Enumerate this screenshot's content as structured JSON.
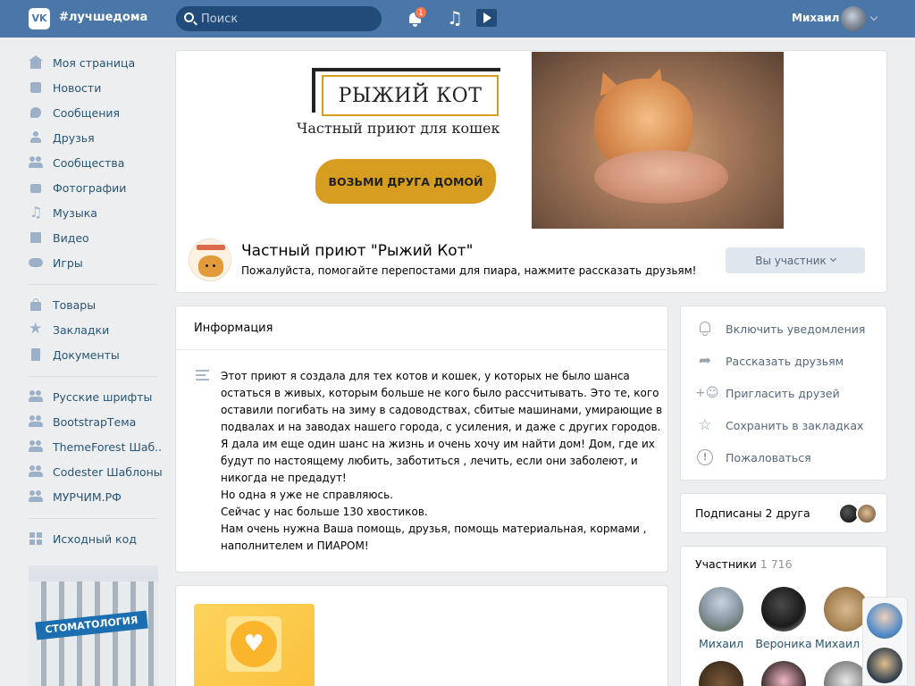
{
  "header": {
    "logo": "VK",
    "hashtag": "#лучшедома",
    "search_placeholder": "Поиск",
    "notifications_badge": "1",
    "user_name": "Михаил"
  },
  "sidebar": {
    "main_items": [
      {
        "label": "Моя страница",
        "icon": "home-icon"
      },
      {
        "label": "Новости",
        "icon": "news-icon"
      },
      {
        "label": "Сообщения",
        "icon": "messages-icon"
      },
      {
        "label": "Друзья",
        "icon": "friends-icon"
      },
      {
        "label": "Сообщества",
        "icon": "communities-icon"
      },
      {
        "label": "Фотографии",
        "icon": "camera-icon"
      },
      {
        "label": "Музыка",
        "icon": "music-icon"
      },
      {
        "label": "Видео",
        "icon": "video-icon"
      },
      {
        "label": "Игры",
        "icon": "gamepad-icon"
      }
    ],
    "secondary_items": [
      {
        "label": "Товары",
        "icon": "bag-icon"
      },
      {
        "label": "Закладки",
        "icon": "star-icon"
      },
      {
        "label": "Документы",
        "icon": "document-icon"
      }
    ],
    "groups": [
      {
        "label": "Русские шрифты"
      },
      {
        "label": "BootstrapТема"
      },
      {
        "label": "ThemeForest Шаб.."
      },
      {
        "label": "Codester Шаблоны"
      },
      {
        "label": "МУРЧИМ.РФ"
      }
    ],
    "source_code": "Исходный код",
    "promo_sign": "СТОМАТОЛОГИЯ"
  },
  "cover": {
    "brand_title": "РЫЖИЙ КОТ",
    "brand_subtitle": "Частный приют для кошек",
    "cta": "ВОЗЬМИ ДРУГА ДОМОЙ"
  },
  "group": {
    "name": "Частный приют \"Рыжий Кот\"",
    "status": "Пожалуйста, помогайте перепостами для пиара, нажмите рассказать друзьям!",
    "member_button": "Вы участник"
  },
  "info": {
    "heading": "Информация",
    "lines": [
      "Этот приют я создала для тех котов и кошек, у которых не было шанса",
      "остаться в живых, которым больше не кого было рассчитывать. Это те, кого",
      "оставили погибать на зиму в садоводствах, сбитые машинами, умирающие в",
      "подвалах и на заводах нашего города, с усиления, и даже с других городов.",
      "Я дала им еще один шанс на жизнь и очень хочу им найти дом! Дом, где их",
      "будут по настоящему любить, заботиться , лечить, если они заболеют, и",
      "никогда не предадут!",
      "Но одна я уже не справляюсь.",
      "Сейчас у нас больше 130 хвостиков.",
      "Нам очень нужна Ваша помощь, друзья, помощь материальная, кормами ,",
      "наполнителем и ПИАРОМ!"
    ]
  },
  "actions": [
    {
      "label": "Включить уведомления",
      "icon": "bell-icon"
    },
    {
      "label": "Рассказать друзьям",
      "icon": "share-icon"
    },
    {
      "label": "Пригласить друзей",
      "icon": "invite-icon"
    },
    {
      "label": "Сохранить в закладках",
      "icon": "star-icon"
    },
    {
      "label": "Пожаловаться",
      "icon": "report-icon"
    }
  ],
  "friends": {
    "text": "Подписаны 2 друга"
  },
  "members": {
    "title": "Участники",
    "count": "1 716",
    "list": [
      {
        "name": "Михаил"
      },
      {
        "name": "Вероника"
      },
      {
        "name": "Михаил"
      }
    ]
  },
  "colors": {
    "header": "#4a76a8",
    "link": "#285473",
    "accent": "#d79d21",
    "background": "#edeef0"
  }
}
